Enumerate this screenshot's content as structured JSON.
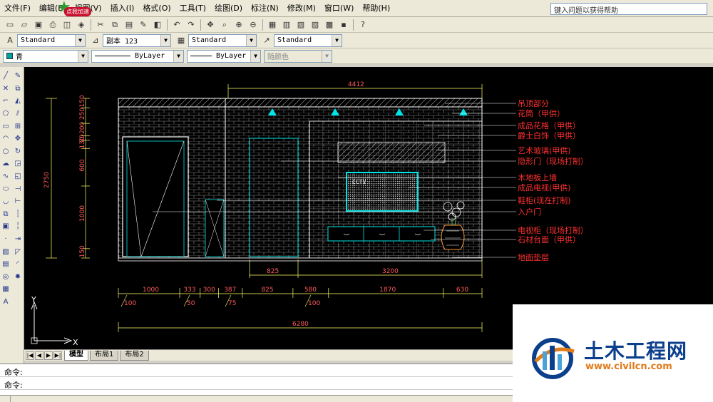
{
  "menubar": {
    "items": [
      "文件(F)",
      "编辑(E)",
      "视图(V)",
      "插入(I)",
      "格式(O)",
      "工具(T)",
      "绘图(D)",
      "标注(N)",
      "修改(M)",
      "窗口(W)",
      "帮助(H)"
    ],
    "help_placeholder": "键入问题以获得帮助",
    "badge": "点我加速"
  },
  "styles_toolbar": {
    "text_style": "Standard",
    "dim_style": "副本 123",
    "table_style": "Standard",
    "multileader_style": "Standard"
  },
  "properties_toolbar": {
    "layer": "青",
    "layer_color": "#00a0a0",
    "linetype": "ByLayer",
    "lineweight": "ByLayer",
    "plot_style": "随颜色"
  },
  "drawing": {
    "labels": [
      "吊顶部分",
      "花筒（甲供）",
      "成品花格（甲供）",
      "爵士白饰（甲供）",
      "艺术玻璃(甲供)",
      "隐形门（现场打制）",
      "木地板上墙",
      "成品电视(甲供)",
      "鞋柜(现在打制)",
      "入户门",
      "电视柜（现场打制）",
      "石材台面（甲供）",
      "地面垫层"
    ],
    "top_dim": "4412",
    "left_total_dim": "2750",
    "left_segments": [
      "150",
      "250",
      "200",
      "70",
      "130",
      "600",
      "1000",
      "150"
    ],
    "mid_dims": [
      "825",
      "3200"
    ],
    "bottom_dims": [
      "1000",
      "333",
      "300",
      "387",
      "825",
      "580",
      "1870",
      "630"
    ],
    "bottom_small_dims": [
      "100",
      "50",
      "75",
      "100"
    ],
    "total_dim": "6280",
    "tv_text": "CCTV",
    "axis_y": "Y",
    "axis_x": "X",
    "colors": {
      "wall": "#ffffff",
      "cyan": "#00e5e5",
      "label": "#ff3030",
      "dim_line": "#ffff66"
    }
  },
  "tabs": [
    "模型",
    "布局1",
    "布局2"
  ],
  "command": {
    "line1": "命令:",
    "line2": "命令:"
  },
  "watermark": {
    "title": "土木工程网",
    "url": "www.civilcn.com"
  }
}
